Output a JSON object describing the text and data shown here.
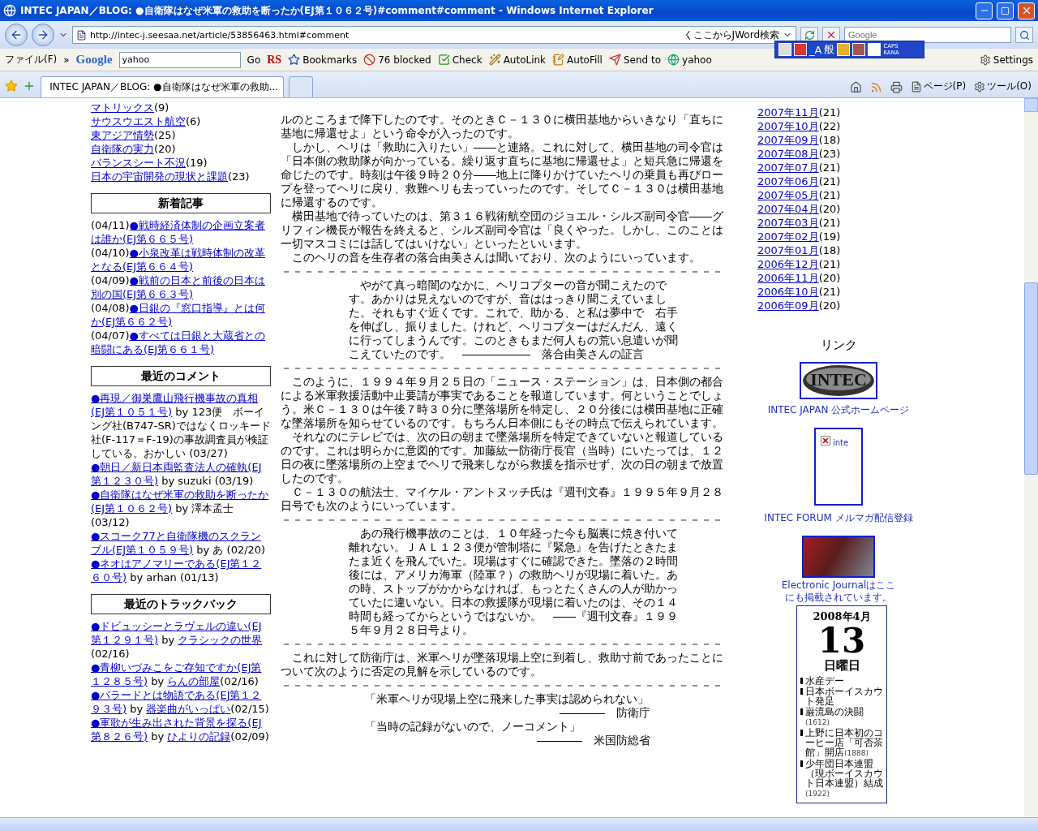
{
  "window": {
    "title": "INTEC JAPAN／BLOG: ●自衛隊はなぜ米軍の救助を断ったか(EJ第１０６２号)#comment#comment - Windows Internet Explorer"
  },
  "address_bar": {
    "url": "http://intec-j.seesaa.net/article/53856463.html#comment",
    "jword": "くここからJWord検索",
    "search_placeholder": "Google"
  },
  "toolbar": {
    "menu": "ファイル(F)",
    "chevron": "»",
    "google_logo": "Google",
    "search_value": "yahoo",
    "go": "Go",
    "rs": "RS",
    "items": [
      {
        "label": "Bookmarks"
      },
      {
        "label": "76 blocked"
      },
      {
        "label": "Check"
      },
      {
        "label": "AutoLink"
      },
      {
        "label": "AutoFill"
      },
      {
        "label": "Send to"
      },
      {
        "label": "yahoo"
      }
    ],
    "settings": "Settings"
  },
  "ime_bar": {
    "mode": "_A",
    "input": "般",
    "caps": "CAPS",
    "kana": "KANA"
  },
  "tabs": [
    {
      "label": "INTEC JAPAN／BLOG: ●自衛隊はなぜ米軍の救助...",
      "selected": true
    }
  ],
  "command_bar": {
    "page": "ページ(P)",
    "tools": "ツール(O)"
  },
  "sidebar": {
    "categories": [
      {
        "name": "マトリックス",
        "count": "(9)"
      },
      {
        "name": "サウスウエスト航空",
        "count": "(6)"
      },
      {
        "name": "東アジア情勢",
        "count": "(25)"
      },
      {
        "name": "自衛隊の実力",
        "count": "(20)"
      },
      {
        "name": "バランスシート不況",
        "count": "(19)"
      },
      {
        "name": "日本の宇宙開発の現状と課題",
        "count": "(23)"
      }
    ],
    "recent_articles": {
      "title": "新着記事",
      "items": [
        {
          "date": "(04/11)",
          "title": "●戦時経済体制の企画立案者は誰か(EJ第６６５号)"
        },
        {
          "date": "(04/10)",
          "title": "●小泉改革は戦時体制の改革となる(EJ第６６４号)"
        },
        {
          "date": "(04/09)",
          "title": "●戦前の日本と前後の日本は別の国(EJ第６６３号)"
        },
        {
          "date": "(04/08)",
          "title": "●日銀の『窓口指導』とは何か(EJ第６６２号)"
        },
        {
          "date": "(04/07)",
          "title": "●すべては日銀と大蔵省との暗闘にある(EJ第６６１号)"
        }
      ]
    },
    "recent_comments": {
      "title": "最近のコメント",
      "items": [
        {
          "title": "●再現／御巣鷹山飛行機事故の真相(EJ第１０５１号)",
          "by": "by 123便　ボーイング社(B747-SR)ではなくロッキード社(F-117＝F-19)の事故調査員が検証している。おかしい",
          "date": "(03/27)"
        },
        {
          "title": "●朝日／新日本両監査法人の確執(EJ第１２３０号)",
          "by": "by suzuki",
          "date": "(03/19)"
        },
        {
          "title": "●自衛隊はなぜ米軍の救助を断ったか(EJ第１０６２号)",
          "by": "by 澤本孟士",
          "date": "(03/12)"
        },
        {
          "title": "●スコーク77と自衛隊機のスクランブル(EJ第１０５９号)",
          "by": "by あ",
          "date": "(02/20)"
        },
        {
          "title": "●ネオはアノマリーである(EJ第１２６０号)",
          "by": "by arhan",
          "date": "(01/13)"
        }
      ]
    },
    "recent_trackbacks": {
      "title": "最近のトラックバック",
      "items": [
        {
          "title": "●ドビュッシーとラヴェルの違い(EJ第１２９１号)",
          "by": "by",
          "blog": "クラシックの世界",
          "date": "(02/16)"
        },
        {
          "title": "●青柳いづみこをご存知ですか(EJ第１２８５号)",
          "by": "by",
          "blog": "らんの部屋",
          "date": "(02/16)"
        },
        {
          "title": "●バラードとは物語である(EJ第１２９３号)",
          "by": "by",
          "blog": "器楽曲がいっぱい",
          "date": "(02/15)"
        },
        {
          "title": "●軍歌が生み出された背景を探る(EJ第８２６号)",
          "by": "by",
          "blog": "ひよりの記録",
          "date": "(02/09)"
        }
      ]
    }
  },
  "article": {
    "blocks": [
      {
        "kind": "paragraph",
        "text": "ルのところまで降下したのです。そのときＣ－１３０に横田基地からいきなり「直ちに基地に帰還せよ」という命令が入ったのです。"
      },
      {
        "kind": "paragraph",
        "text": "　しかし、ヘリは「救助に入りたい」――と連絡。これに対して、横田基地の司令官は「日本側の救助隊が向かっている。繰り返す直ちに基地に帰還せよ」と短兵急に帰還を命じたのです。時刻は午後９時２０分――地上に降りかけていたヘリの乗員も再びロープを登ってヘリに戻り、救難ヘリも去っていったのです。そしてＣ－１３０は横田基地に帰還するのです。"
      },
      {
        "kind": "paragraph",
        "text": "　横田基地で待っていたのは、第３１６戦術航空団のジョエル・シルズ副司令官――グリフィン機長が報告を終えると、シルズ副司令官は「良くやった。しかし、このことは一切マスコミには話してはいけない」といったといいます。"
      },
      {
        "kind": "paragraph",
        "text": "　このヘリの音を生存者の落合由美さんは聞いており、次のようにいっています。"
      },
      {
        "kind": "rule",
        "text": "－－－－－－－－－－－－－－－－－－－－－－－－－－－－－－－－－－－－－－－"
      },
      {
        "kind": "quote",
        "text": "　やがて真っ暗闇のなかに、ヘリコプターの音が聞こえたのです。あかりは見えないのですが、音ははっきり聞こえていました。それもすぐ近くです。これで、助かる、と私は夢中で　右手を伸ばし、振りました。けれど、ヘリコプターはだんだん、遠くに行ってしまうんです。このときもまだ何人もの荒い息遣いが聞こえていたのです。　――――――　落合由美さんの証言"
      },
      {
        "kind": "rule",
        "text": "－－－－－－－－－－－－－－－－－－－－－－－－－－－－－－－－－－－－－－－"
      },
      {
        "kind": "paragraph",
        "text": "　このように、１９９４年９月２５日の「ニュース・ステーション」は、日本側の都合による米軍救援活動中止要請が事実であることを報道しています。何ということでしょう。米Ｃ－１３０は午後７時３０分に墜落場所を特定し、２０分後には横田基地に正確な墜落場所を知らせているのです。もちろん日本側にもその時点で伝えられています。"
      },
      {
        "kind": "paragraph",
        "text": "　それなのにテレビでは、次の日の朝まで墜落場所を特定できていないと報道しているのです。これは明らかに意図的です。加藤紘一防衛庁長官（当時）にいたっては、１２日の夜に墜落場所の上空までヘリで飛来しながら救援を指示せず、次の日の朝まで放置したのです。"
      },
      {
        "kind": "paragraph",
        "text": "　Ｃ－１３０の航法士、マイケル・アントヌッチ氏は『週刊文春』１９９５年９月２８日号でも次のようにいっています。"
      },
      {
        "kind": "rule",
        "text": "－－－－－－－－－－－－－－－－－－－－－－－－－－－－－－－－－－－－－－－"
      },
      {
        "kind": "quote",
        "text": "　あの飛行機事故のことは、１０年経った今も脳裏に焼き付いて離れない。ＪＡＬ１２３便が管制塔に『緊急』を告げたときたまたま近くを飛んでいた。現場はすぐに確認できた。墜落の２時間後には、アメリカ海軍（陸軍？）の救助ヘリが現場に着いた。あの時、ストップがかからなければ、もっとたくさんの人が助かっていたに違いない。日本の救援隊が現場に着いたのは、その１４時間も経ってからというではないか。　――『週刊文春』１９９５年９月２８日号より。"
      },
      {
        "kind": "rule",
        "text": "－－－－－－－－－－－－－－－－－－－－－－－－－－－－－－－－－－－－－－－"
      },
      {
        "kind": "paragraph",
        "text": "　これに対して防衛庁は、米軍ヘリが墜落現場上空に到着し、救助寸前であったことについて次のように否定の見解を示しているのです。"
      },
      {
        "kind": "rule",
        "text": "－－－－－－－－－－－－－－－－－－－－－－－－－－－－－－－－－－－－－－－"
      },
      {
        "kind": "statement",
        "text": "「米軍ヘリが現場上空に飛来した事実は認められない」",
        "source": "――――　防衛庁"
      },
      {
        "kind": "statement",
        "text": "「当時の記録がないので、ノーコメント」",
        "source": "――――　米国防総省"
      }
    ]
  },
  "right": {
    "archives": [
      {
        "month": "2007年11月",
        "count": "(21)"
      },
      {
        "month": "2007年10月",
        "count": "(22)"
      },
      {
        "month": "2007年09月",
        "count": "(18)"
      },
      {
        "month": "2007年08月",
        "count": "(23)"
      },
      {
        "month": "2007年07月",
        "count": "(21)"
      },
      {
        "month": "2007年06月",
        "count": "(21)"
      },
      {
        "month": "2007年05月",
        "count": "(21)"
      },
      {
        "month": "2007年04月",
        "count": "(20)"
      },
      {
        "month": "2007年03月",
        "count": "(21)"
      },
      {
        "month": "2007年02月",
        "count": "(19)"
      },
      {
        "month": "2007年01月",
        "count": "(18)"
      },
      {
        "month": "2006年12月",
        "count": "(21)"
      },
      {
        "month": "2006年11月",
        "count": "(20)"
      },
      {
        "month": "2006年10月",
        "count": "(21)"
      },
      {
        "month": "2006年09月",
        "count": "(20)"
      }
    ],
    "links": {
      "title": "リンク",
      "items": [
        {
          "kind": "logo",
          "logo_text": "INTEC",
          "caption": "INTEC JAPAN 公式ホームページ"
        },
        {
          "kind": "broken",
          "alt": "inte",
          "caption": "INTEC FORUM メルマガ配信登録"
        },
        {
          "kind": "banner",
          "caption": "Electronic Journalはここにも掲載されています。"
        }
      ]
    },
    "calendar": {
      "month": "2008年4月",
      "day": "13",
      "weekday": "日曜日",
      "events": [
        {
          "text": "水産デー"
        },
        {
          "text": "日本ボーイスカウト発足"
        },
        {
          "text": "巌流島の決闘",
          "year": "(1612)"
        },
        {
          "text": "上野に日本初のコーヒー店「可否茶館」開店",
          "year": "(1888)"
        },
        {
          "text": "少年団日本連盟（現ボーイスカウト日本連盟）結成",
          "year": "(1922)"
        }
      ]
    }
  }
}
